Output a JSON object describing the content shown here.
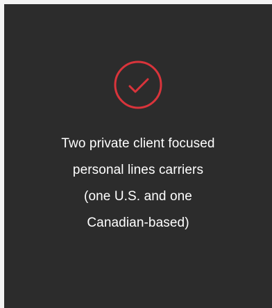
{
  "card": {
    "icon": "check-circle-icon",
    "accent_color": "#d9343b",
    "lines": [
      "Two private client focused",
      "personal lines carriers",
      "(one U.S. and one",
      "Canadian-based)"
    ]
  }
}
